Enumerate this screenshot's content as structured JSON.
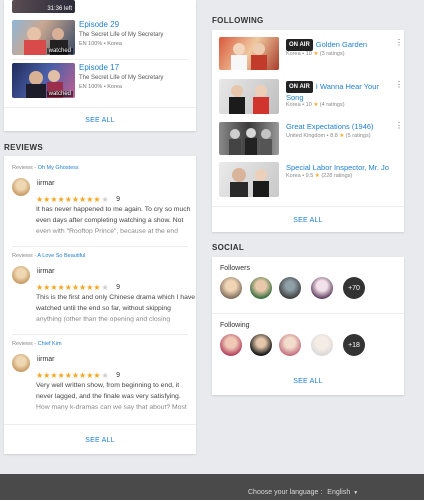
{
  "watched": {
    "top_badge": "31:36 left",
    "items": [
      {
        "title": "Episode 29",
        "show": "The Secret Life of My Secretary",
        "meta": "EN 100% • Korea",
        "badge": "watched"
      },
      {
        "title": "Episode 17",
        "show": "The Secret Life of My Secretary",
        "meta": "EN 100% • Korea",
        "badge": "watched"
      }
    ],
    "see_all": "SEE ALL"
  },
  "reviews": {
    "heading": "REVIEWS",
    "prefix": "Reviews",
    "items": [
      {
        "drama": "Oh My Ghostess",
        "user": "iirmar",
        "score": "9",
        "text": "It has never happened to me again. To cry so much even days after completing watching a show. Not even with \"Rooftop Prince\", because at the end"
      },
      {
        "drama": "A Love So Beautiful",
        "user": "iirmar",
        "score": "9",
        "text": "This is the first and only Chinese drama which I have watched until the end so far, without skipping anything (other than the opening and closing"
      },
      {
        "drama": "Chief Kim",
        "user": "iirmar",
        "score": "9",
        "text": "Very well written show, from beginning to end, it never lagged, and the finale was very satisfying. How many k-dramas can we say that about? Most"
      }
    ],
    "see_all": "SEE ALL"
  },
  "following": {
    "heading": "FOLLOWING",
    "items": [
      {
        "onair": "ON AIR",
        "title": "Golden Garden",
        "country": "Korea",
        "rating": "10",
        "ratings": "(3 ratings)"
      },
      {
        "onair": "ON AIR",
        "title": "I Wanna Hear Your Song",
        "country": "Korea",
        "rating": "10",
        "ratings": "(4 ratings)"
      },
      {
        "onair": "",
        "title": "Great Expectations (1946)",
        "country": "United Kingdom",
        "rating": "8.8",
        "ratings": "(5 ratings)"
      },
      {
        "onair": "",
        "title": "Special Labor Inspector, Mr. Jo",
        "country": "Korea",
        "rating": "9.5",
        "ratings": "(228 ratings)"
      }
    ],
    "see_all": "SEE ALL"
  },
  "social": {
    "heading": "SOCIAL",
    "followers_label": "Followers",
    "followers_more": "+70",
    "following_label": "Following",
    "following_more": "+18",
    "see_all": "SEE ALL"
  },
  "footer": {
    "choose_language": "Choose your language :",
    "language": "English"
  },
  "colors": {
    "accent": "#1f7fd1",
    "star": "#f5a623",
    "footer": "#4a4a4a"
  }
}
